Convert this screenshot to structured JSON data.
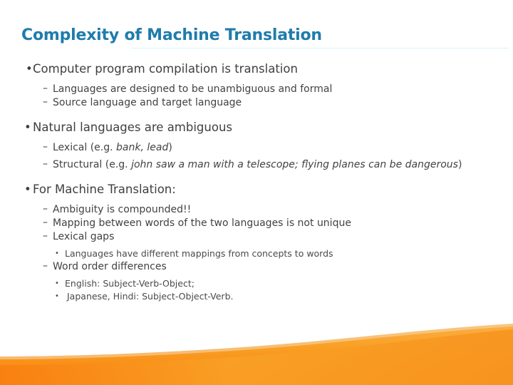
{
  "slide": {
    "title": "Complexity of Machine Translation",
    "title_color": "#1f7cac",
    "background_color": "#ffffff",
    "accent_wave_color_top": "#fbae3a",
    "accent_wave_color_mid": "#f99a1c",
    "accent_wave_color_bottom": "#f98010",
    "divider_color": "#d6f4fb"
  },
  "markers": {
    "level1": "•",
    "level2": "–",
    "level3": "•"
  },
  "content": {
    "b1": {
      "text": "Computer program compilation is translation",
      "subs": [
        "Languages are designed to be unambiguous and formal",
        "Source language and target language"
      ]
    },
    "b2": {
      "text": "Natural languages are ambiguous",
      "sub1_pre": "Lexical (e.g. ",
      "sub1_italic": "bank, lead",
      "sub1_post": ")",
      "sub2_pre": "Structural (e.g. ",
      "sub2_italic": "john saw a man with a telescope; flying planes can be dangerous",
      "sub2_post": ")"
    },
    "b3": {
      "text": "For Machine Translation:",
      "sub1": "Ambiguity is compounded!!",
      "sub2": "Mapping between words of the two languages is not unique",
      "sub3": "Lexical gaps",
      "sub3_child": "Languages have different mappings from concepts to words",
      "sub4": "Word order differences",
      "sub4_child1": "English: Subject-Verb-Object;",
      "sub4_child2": " Japanese, Hindi: Subject-Object-Verb."
    }
  }
}
